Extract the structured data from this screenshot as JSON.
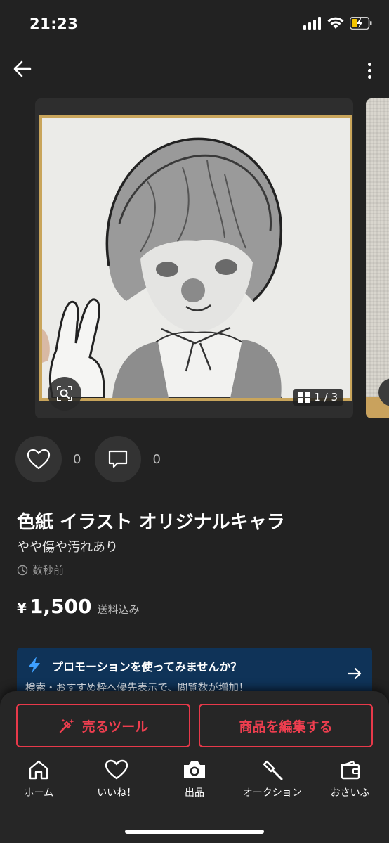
{
  "status_bar": {
    "time": "21:23"
  },
  "nav": {
    "back_icon": "arrow-left-icon",
    "more_icon": "more-vertical-icon"
  },
  "gallery": {
    "page_indicator": "1 / 3",
    "lens_icon": "image-search-icon",
    "grid_icon": "grid-icon"
  },
  "reactions": {
    "likes": "0",
    "comments": "0"
  },
  "item": {
    "title": "色紙 イラスト オリジナルキャラ",
    "condition": "やや傷や汚れあり",
    "posted": "数秒前",
    "price_symbol": "¥",
    "price": "1,500",
    "shipping": "送料込み"
  },
  "promo": {
    "title": "プロモーションを使ってみませんか？",
    "description": "検索・おすすめ枠へ優先表示で、閲覧数が増加！",
    "bg_color": "#0f3358"
  },
  "actions": {
    "sell_tools": "売るツール",
    "edit_item": "商品を編集する",
    "accent_color": "#e8394a"
  },
  "tabbar": {
    "home": "ホーム",
    "likes": "いいね！",
    "listing": "出品",
    "auction": "オークション",
    "wallet": "おさいふ"
  }
}
